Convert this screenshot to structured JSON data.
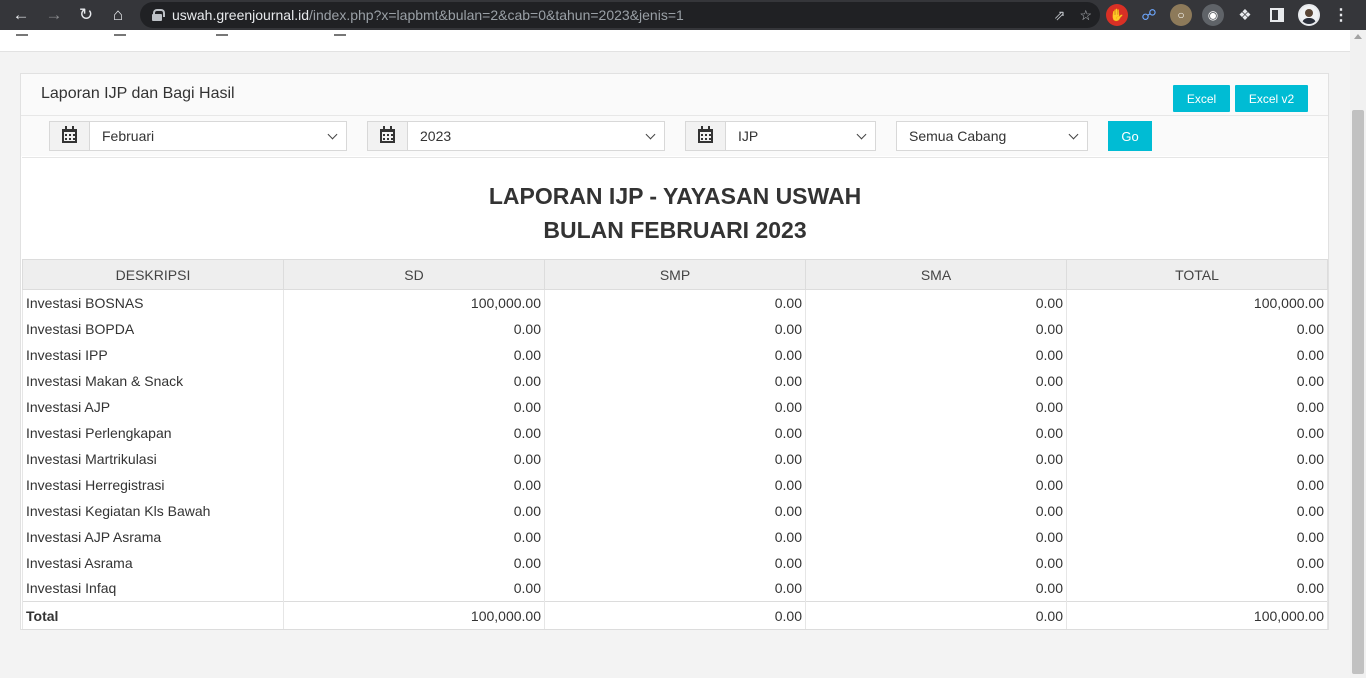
{
  "browser": {
    "url_host": "uswah.greenjournal.id",
    "url_path": "/index.php?x=lapbmt&bulan=2&cab=0&tahun=2023&jenis=1"
  },
  "panel": {
    "title": "Laporan IJP dan Bagi Hasil",
    "buttons": {
      "excel": "Excel",
      "excel_v2": "Excel v2"
    }
  },
  "filters": {
    "month": "Februari",
    "year": "2023",
    "type": "IJP",
    "branch": "Semua Cabang",
    "go": "Go"
  },
  "report": {
    "title_line1": "LAPORAN IJP - YAYASAN USWAH",
    "title_line2": "BULAN FEBRUARI 2023"
  },
  "table": {
    "headers": [
      "DESKRIPSI",
      "SD",
      "SMP",
      "SMA",
      "TOTAL"
    ],
    "rows": [
      {
        "desc": "Investasi BOSNAS",
        "sd": "100,000.00",
        "smp": "0.00",
        "sma": "0.00",
        "total": "100,000.00"
      },
      {
        "desc": "Investasi BOPDA",
        "sd": "0.00",
        "smp": "0.00",
        "sma": "0.00",
        "total": "0.00"
      },
      {
        "desc": "Investasi IPP",
        "sd": "0.00",
        "smp": "0.00",
        "sma": "0.00",
        "total": "0.00"
      },
      {
        "desc": "Investasi Makan & Snack",
        "sd": "0.00",
        "smp": "0.00",
        "sma": "0.00",
        "total": "0.00"
      },
      {
        "desc": "Investasi AJP",
        "sd": "0.00",
        "smp": "0.00",
        "sma": "0.00",
        "total": "0.00"
      },
      {
        "desc": "Investasi Perlengkapan",
        "sd": "0.00",
        "smp": "0.00",
        "sma": "0.00",
        "total": "0.00"
      },
      {
        "desc": "Investasi Martrikulasi",
        "sd": "0.00",
        "smp": "0.00",
        "sma": "0.00",
        "total": "0.00"
      },
      {
        "desc": "Investasi Herregistrasi",
        "sd": "0.00",
        "smp": "0.00",
        "sma": "0.00",
        "total": "0.00"
      },
      {
        "desc": "Investasi Kegiatan Kls Bawah",
        "sd": "0.00",
        "smp": "0.00",
        "sma": "0.00",
        "total": "0.00"
      },
      {
        "desc": "Investasi AJP Asrama",
        "sd": "0.00",
        "smp": "0.00",
        "sma": "0.00",
        "total": "0.00"
      },
      {
        "desc": "Investasi Asrama",
        "sd": "0.00",
        "smp": "0.00",
        "sma": "0.00",
        "total": "0.00"
      },
      {
        "desc": "Investasi Infaq",
        "sd": "0.00",
        "smp": "0.00",
        "sma": "0.00",
        "total": "0.00"
      }
    ],
    "total": {
      "desc": "Total",
      "sd": "100,000.00",
      "smp": "0.00",
      "sma": "0.00",
      "total": "100,000.00"
    }
  }
}
